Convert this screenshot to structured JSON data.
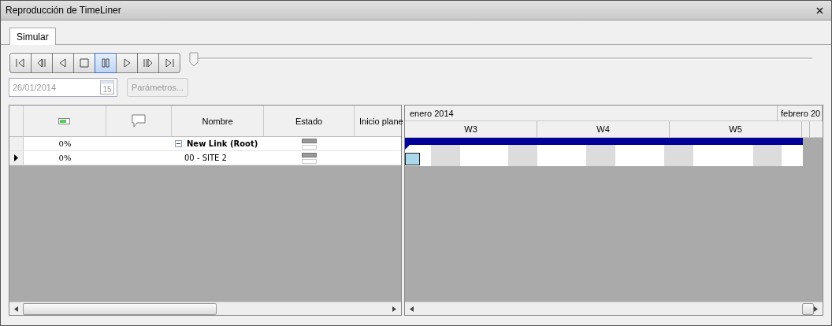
{
  "window": {
    "title": "Reproducción de TimeLiner"
  },
  "tabs": [
    {
      "label": "Simular",
      "selected": true
    }
  ],
  "playback_buttons": [
    {
      "kind": "first",
      "selected": false
    },
    {
      "kind": "step-back",
      "selected": false
    },
    {
      "kind": "play-back",
      "selected": false
    },
    {
      "kind": "stop",
      "selected": false
    },
    {
      "kind": "pause",
      "selected": true
    },
    {
      "kind": "play",
      "selected": false
    },
    {
      "kind": "step-forward",
      "selected": false
    },
    {
      "kind": "last",
      "selected": false
    }
  ],
  "slider": {
    "level": 0
  },
  "date_field": {
    "value": "26/01/2014",
    "calendar_day": "15",
    "disabled": true
  },
  "params_button": {
    "label": "Parámetros...",
    "disabled": true
  },
  "grid": {
    "columns": [
      {
        "kind": "progress"
      },
      {
        "kind": "comment"
      },
      {
        "kind": "text",
        "label": "Nombre"
      },
      {
        "kind": "text",
        "label": "Estado"
      },
      {
        "kind": "text",
        "label": "Inicio plane"
      }
    ],
    "rows": [
      {
        "kind": "group",
        "progress": "0%",
        "name": "New Link (Root)",
        "expanded": true,
        "selected": false
      },
      {
        "kind": "task",
        "progress": "0%",
        "name": "00 - SITE 2",
        "selected": true
      }
    ]
  },
  "gantt": {
    "months": [
      "enero 2014",
      "febrero 20"
    ],
    "weeks": [
      "W3",
      "W4",
      "W5"
    ]
  }
}
